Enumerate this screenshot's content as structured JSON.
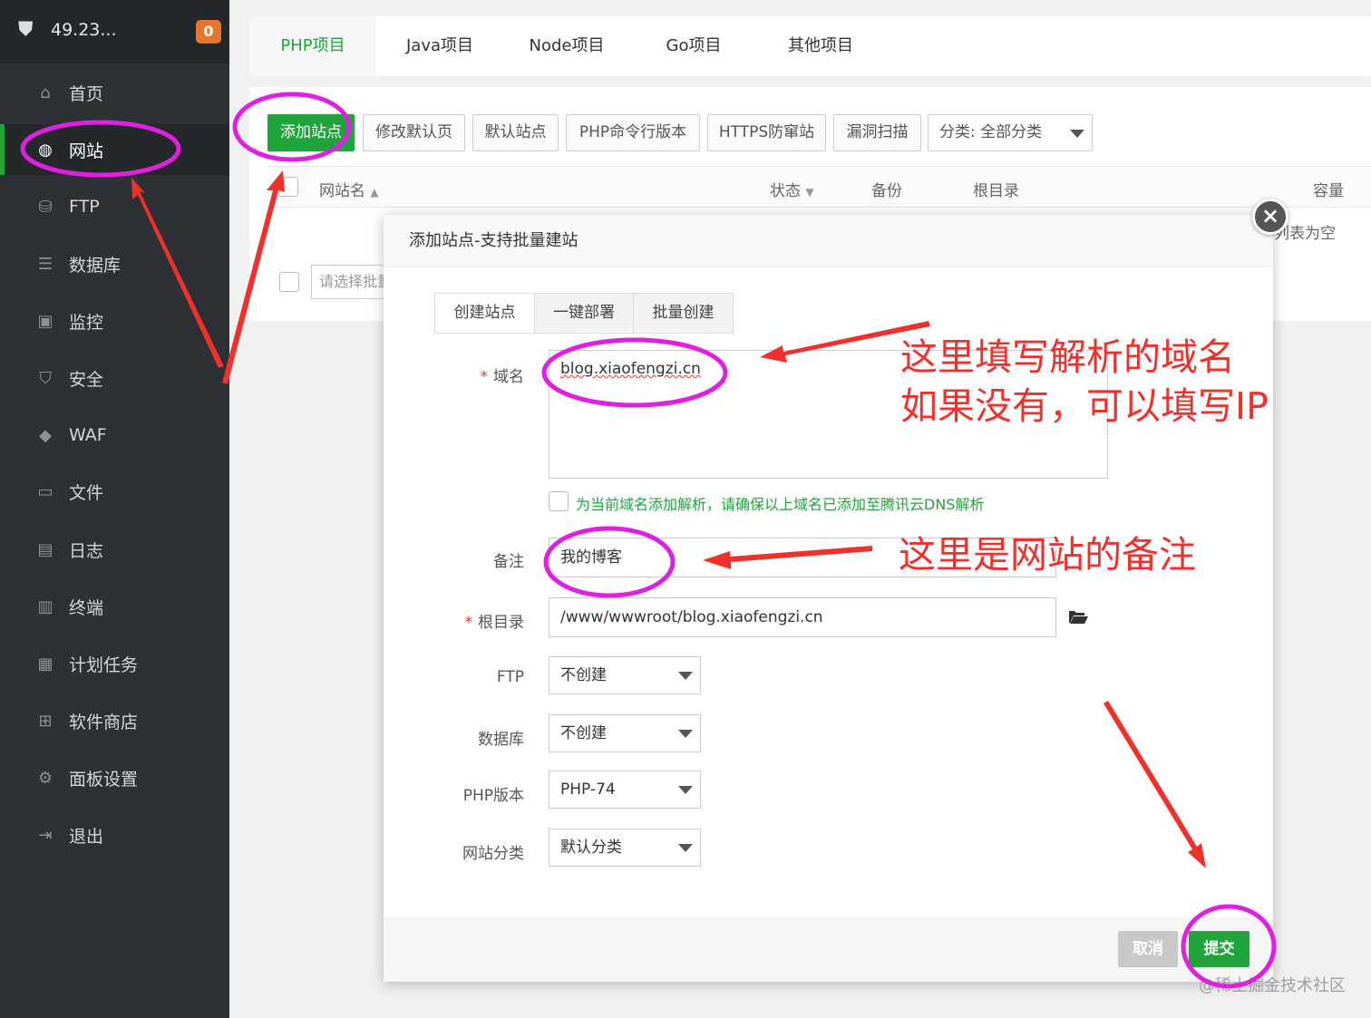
{
  "sidebar": {
    "ip": "49.23...",
    "badge": "0",
    "items": [
      {
        "label": "首页",
        "icon": "home-icon",
        "glyph": "⌂"
      },
      {
        "label": "网站",
        "icon": "globe-icon",
        "glyph": "◍"
      },
      {
        "label": "FTP",
        "icon": "ftp-icon",
        "glyph": "⛁"
      },
      {
        "label": "数据库",
        "icon": "database-icon",
        "glyph": "☰"
      },
      {
        "label": "监控",
        "icon": "monitor-icon",
        "glyph": "▣"
      },
      {
        "label": "安全",
        "icon": "shield-icon",
        "glyph": "⛉"
      },
      {
        "label": "WAF",
        "icon": "waf-shield-icon",
        "glyph": "◆"
      },
      {
        "label": "文件",
        "icon": "folder-icon",
        "glyph": "▭"
      },
      {
        "label": "日志",
        "icon": "log-icon",
        "glyph": "▤"
      },
      {
        "label": "终端",
        "icon": "terminal-icon",
        "glyph": "▥"
      },
      {
        "label": "计划任务",
        "icon": "calendar-icon",
        "glyph": "▦"
      },
      {
        "label": "软件商店",
        "icon": "grid-icon",
        "glyph": "⊞"
      },
      {
        "label": "面板设置",
        "icon": "gear-icon",
        "glyph": "⚙"
      },
      {
        "label": "退出",
        "icon": "logout-icon",
        "glyph": "⇥"
      }
    ]
  },
  "project_tabs": [
    "PHP项目",
    "Java项目",
    "Node项目",
    "Go项目",
    "其他项目"
  ],
  "toolbar": {
    "add_site": "添加站点",
    "edit_default_page": "修改默认页",
    "default_site": "默认站点",
    "php_cli_version": "PHP命令行版本",
    "https_protection": "HTTPS防窜站",
    "vuln_scan": "漏洞扫描",
    "category": "分类: 全部分类"
  },
  "table": {
    "col_name": "网站名",
    "col_status": "状态",
    "col_backup": "备份",
    "col_root": "根目录",
    "col_capacity": "容量",
    "empty_tip": "列表为空",
    "batch_placeholder": "请选择批量操作"
  },
  "modal": {
    "title": "添加站点-支持批量建站",
    "tabs": [
      "创建站点",
      "一键部署",
      "批量创建"
    ],
    "domain_label": "域名",
    "domain_value": "blog.xiaofengzi.cn",
    "dns_hint": "为当前域名添加解析，请确保以上域名已添加至腾讯云DNS解析",
    "remark_label": "备注",
    "remark_value": "我的博客",
    "root_label": "根目录",
    "root_value": "/www/wwwroot/blog.xiaofengzi.cn",
    "ftp_label": "FTP",
    "ftp_value": "不创建",
    "db_label": "数据库",
    "db_value": "不创建",
    "php_label": "PHP版本",
    "php_value": "PHP-74",
    "category_label": "网站分类",
    "category_value": "默认分类",
    "cancel": "取消",
    "submit": "提交"
  },
  "annotations": {
    "domain_line1": "这里填写解析的域名",
    "domain_line2": "如果没有，可以填写IP",
    "remark": "这里是网站的备注"
  },
  "watermark": "@稀土掘金技术社区",
  "colors": {
    "accent": "#20a53a",
    "sidebar": "#2d3135",
    "annotation": "#f0302b",
    "highlight_circle": "#e020e0",
    "badge": "#e4762e"
  }
}
